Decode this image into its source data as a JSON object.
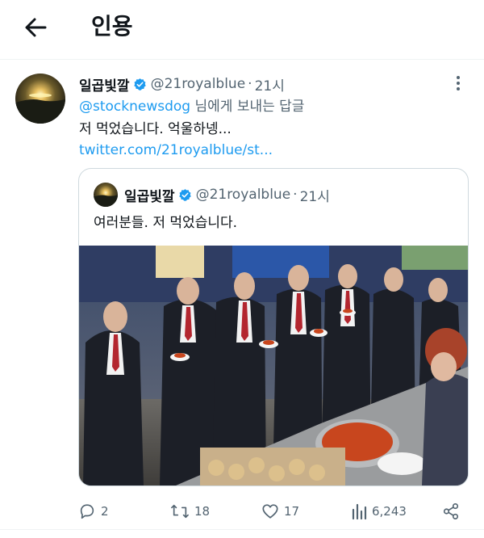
{
  "header": {
    "title": "인용",
    "back_icon": "arrow-left-icon"
  },
  "tweet": {
    "author_name": "일곱빛깔",
    "handle": "@21royalblue",
    "separator": "·",
    "time": "21시",
    "verified_icon": "verified-badge-icon",
    "more_icon": "more-vertical-icon",
    "reply_mention": "@stocknewsdog",
    "reply_suffix": " 님에게 보내는 답글",
    "text": "저 먹었습니다. 억울하넹...",
    "link": "twitter.com/21royalblue/st..."
  },
  "quoted": {
    "author_name": "일곱빛깔",
    "handle": "@21royalblue",
    "separator": "·",
    "time": "21시",
    "text": "여러분들. 저 먹었습니다."
  },
  "actions": {
    "replies": "2",
    "retweets": "18",
    "likes": "17",
    "views": "6,243"
  },
  "colors": {
    "accent": "#1d9bf0",
    "secondary_text": "#536471",
    "border": "#cfd9de"
  }
}
